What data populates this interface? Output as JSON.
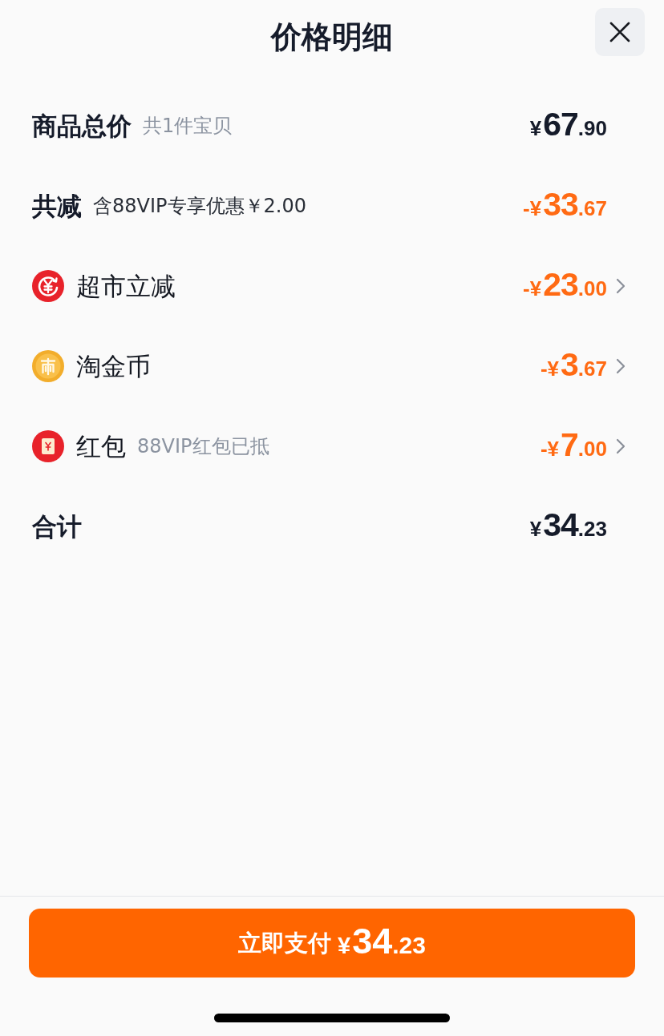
{
  "header": {
    "title": "价格明细"
  },
  "rows": [
    {
      "kind": "subtotal",
      "label": "商品总价",
      "note": "共1件宝贝",
      "amount": "¥67.90"
    },
    {
      "kind": "savings",
      "label": "共减",
      "note": "含88VIP专享优惠￥2.00",
      "amount": "-¥33.67"
    },
    {
      "kind": "promo",
      "label": "超市立减",
      "amount": "-¥23.00"
    },
    {
      "kind": "coins",
      "label": "淘金币",
      "amount": "-¥3.67"
    },
    {
      "kind": "packet",
      "label": "红包",
      "note": "88VIP红包已抵",
      "amount": "-¥7.00"
    },
    {
      "kind": "total",
      "label": "合计",
      "amount": "¥34.23"
    }
  ],
  "pay_button": {
    "label": "立即支付",
    "amount": "¥34.23"
  }
}
